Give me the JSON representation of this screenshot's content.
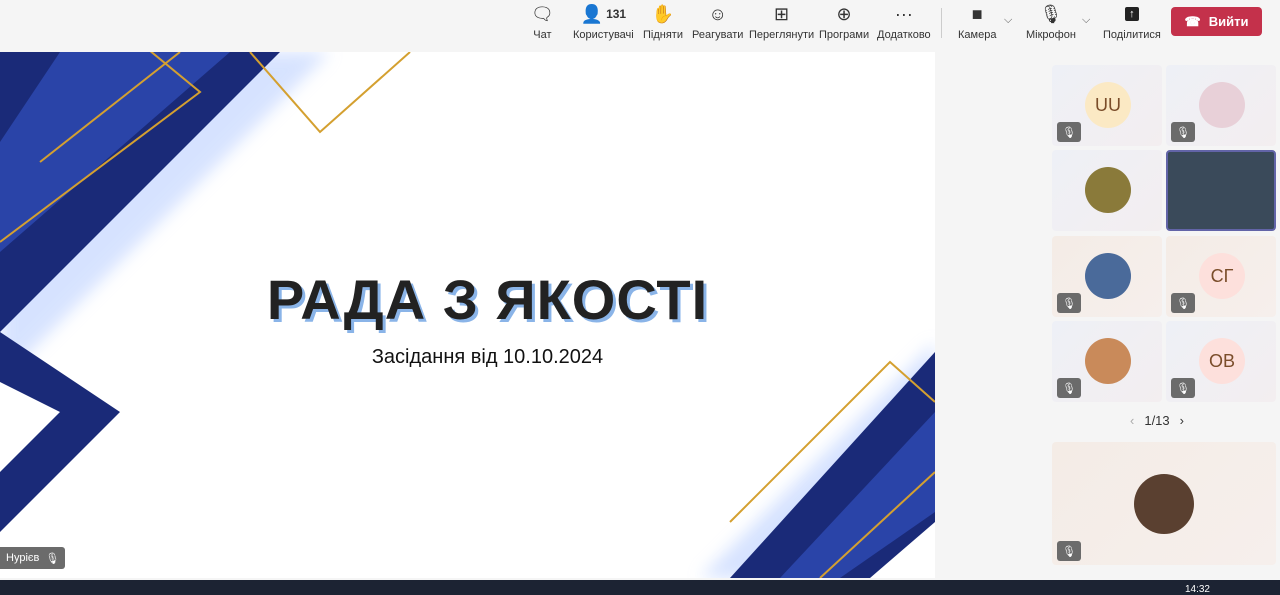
{
  "toolbar": {
    "items": [
      {
        "label": "Чат",
        "icon": "chat-icon"
      },
      {
        "label": "Користувачі",
        "icon": "people-icon",
        "count": "131"
      },
      {
        "label": "Підняти",
        "icon": "raise-hand-icon"
      },
      {
        "label": "Реагувати",
        "icon": "smile-icon"
      },
      {
        "label": "Переглянути",
        "icon": "grid-icon"
      },
      {
        "label": "Програми",
        "icon": "plus-icon"
      },
      {
        "label": "Додатково",
        "icon": "more-icon"
      },
      {
        "label": "Камера",
        "icon": "camera-off-icon"
      },
      {
        "label": "Мікрофон",
        "icon": "mic-off-icon"
      },
      {
        "label": "Поділитися",
        "icon": "share-icon"
      }
    ],
    "leave_label": "Вийти"
  },
  "slide": {
    "title": "РАДА З ЯКОСТІ",
    "subtitle": "Засідання від 10.10.2024"
  },
  "presenter_name": "Нурієв",
  "participants": [
    {
      "initials": "UU",
      "color": "#fbe9c4"
    },
    {
      "initials": "",
      "color": "#e8d0d8"
    },
    {
      "initials": "",
      "color": "#8a7a3a"
    },
    {
      "initials": "",
      "color": "#3a4a5a"
    },
    {
      "initials": "",
      "color": "#4a6a9a"
    },
    {
      "initials": "СГ",
      "color": "#fde0dc"
    },
    {
      "initials": "",
      "color": "#c98a5a"
    },
    {
      "initials": "ОВ",
      "color": "#fde0dc"
    }
  ],
  "pager": "1/13",
  "clock": "14:32"
}
